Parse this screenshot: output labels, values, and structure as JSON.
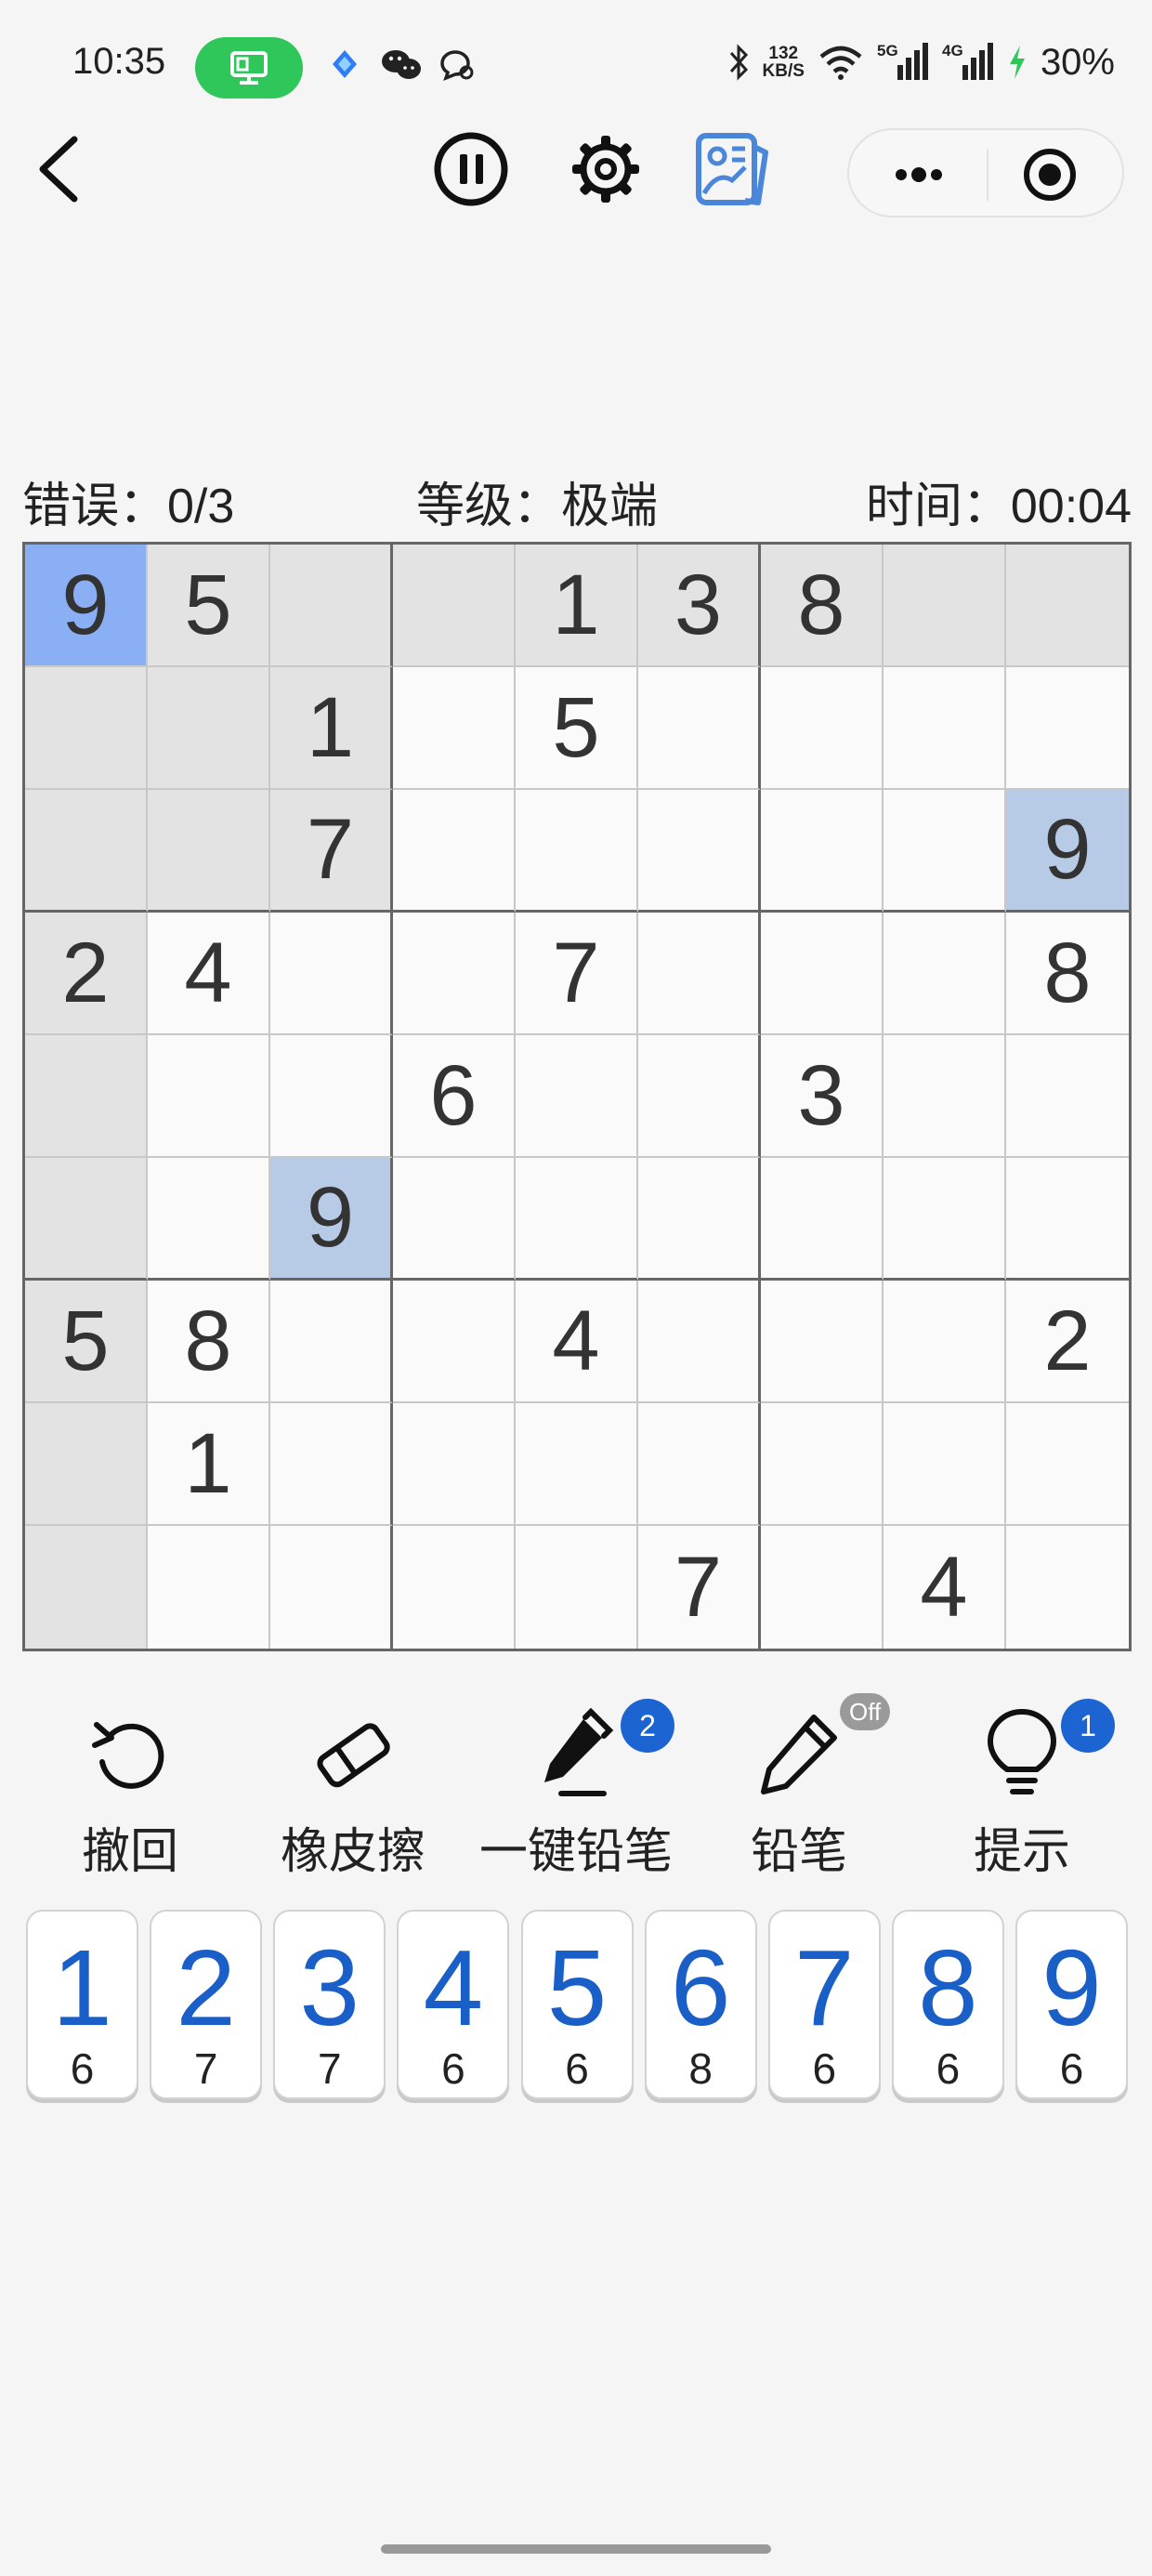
{
  "status_bar": {
    "time": "10:35",
    "speed_value": "132",
    "speed_unit": "KB/S",
    "net_5g": "5G",
    "net_4g": "4G",
    "battery": "30%",
    "pill_color": "#2fc65a"
  },
  "nav": {
    "back_icon": "chevron-left-icon",
    "pause_icon": "pause-circle-icon",
    "settings_icon": "gear-icon",
    "theme_icon": "image-card-icon",
    "more_icon": "ellipsis-icon",
    "target_icon": "target-icon"
  },
  "info": {
    "errors_label": "错误：",
    "errors_value": "0/3",
    "level_label": "等级：",
    "level_value": "极端",
    "time_label": "时间：",
    "time_value": "00:04"
  },
  "board": {
    "rows": [
      [
        "9",
        "5",
        "",
        "",
        "1",
        "3",
        "8",
        "",
        ""
      ],
      [
        "",
        "",
        "1",
        "",
        "5",
        "",
        "",
        "",
        ""
      ],
      [
        "",
        "",
        "7",
        "",
        "",
        "",
        "",
        "",
        "9"
      ],
      [
        "2",
        "4",
        "",
        "",
        "7",
        "",
        "",
        "",
        "8"
      ],
      [
        "",
        "",
        "",
        "6",
        "",
        "",
        "3",
        "",
        ""
      ],
      [
        "",
        "",
        "9",
        "",
        "",
        "",
        "",
        "",
        ""
      ],
      [
        "5",
        "8",
        "",
        "",
        "4",
        "",
        "",
        "",
        "2"
      ],
      [
        "",
        "1",
        "",
        "",
        "",
        "",
        "",
        "",
        ""
      ],
      [
        "",
        "",
        "",
        "",
        "",
        "7",
        "",
        "4",
        ""
      ]
    ],
    "selected_cell": [
      0,
      0
    ],
    "highlight_color": "#b7cbe6",
    "selected_color": "#8aaff5",
    "shade_color": "#e3e3e3"
  },
  "tools": [
    {
      "label": "撤回",
      "icon": "undo-icon"
    },
    {
      "label": "橡皮擦",
      "icon": "eraser-icon"
    },
    {
      "label": "一键铅笔",
      "icon": "auto-pen-icon",
      "badge": "2"
    },
    {
      "label": "铅笔",
      "icon": "pencil-icon",
      "badge": "Off"
    },
    {
      "label": "提示",
      "icon": "lightbulb-icon",
      "badge": "1"
    }
  ],
  "keys": [
    {
      "number": "1",
      "count": "6"
    },
    {
      "number": "2",
      "count": "7"
    },
    {
      "number": "3",
      "count": "7"
    },
    {
      "number": "4",
      "count": "6"
    },
    {
      "number": "5",
      "count": "6"
    },
    {
      "number": "6",
      "count": "8"
    },
    {
      "number": "7",
      "count": "6"
    },
    {
      "number": "8",
      "count": "6"
    },
    {
      "number": "9",
      "count": "6"
    }
  ],
  "accent_color": "#1a5fc8"
}
